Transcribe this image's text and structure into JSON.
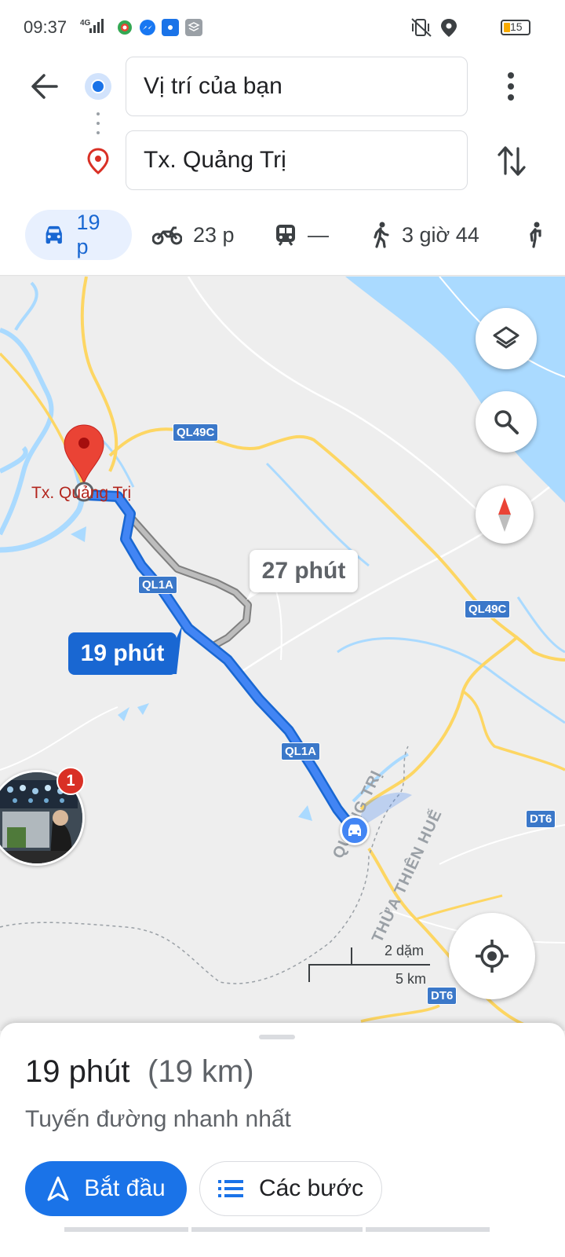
{
  "status_bar": {
    "time": "09:37",
    "network": "4G",
    "battery": "15",
    "icons": [
      "signal-icon",
      "chrome-icon",
      "messenger-icon",
      "hotspot-icon",
      "stack-icon",
      "vibrate-icon",
      "location-icon",
      "battery-icon"
    ]
  },
  "directions": {
    "origin": "Vị trí của bạn",
    "destination": "Tx. Quảng Trị"
  },
  "modes": [
    {
      "name": "car",
      "label": "19 p",
      "active": true
    },
    {
      "name": "motorbike",
      "label": "23 p"
    },
    {
      "name": "transit",
      "label": "—"
    },
    {
      "name": "walk",
      "label": "3 giờ 44"
    }
  ],
  "map": {
    "destination_label": "Tx. Quảng Trị",
    "alt_route_time": "27 phút",
    "main_route_time": "19 phút",
    "roads": [
      "QL49C",
      "QL1A",
      "QL1A",
      "QL49C",
      "DT6",
      "DT6"
    ],
    "provinces": [
      "QUẢNG TRỊ",
      "THỪA THIÊN HUẾ"
    ],
    "scale_top": "2 dặm",
    "scale_bottom": "5 km",
    "notification_count": "1",
    "colors": {
      "route": "#4285f4",
      "alt_route": "#9e9e9e",
      "water": "#aadaff",
      "highway": "#fdd663"
    }
  },
  "sheet": {
    "duration": "19 phút",
    "distance": "(19 km)",
    "subtitle": "Tuyến đường nhanh nhất",
    "start_label": "Bắt đầu",
    "steps_label": "Các bước"
  }
}
